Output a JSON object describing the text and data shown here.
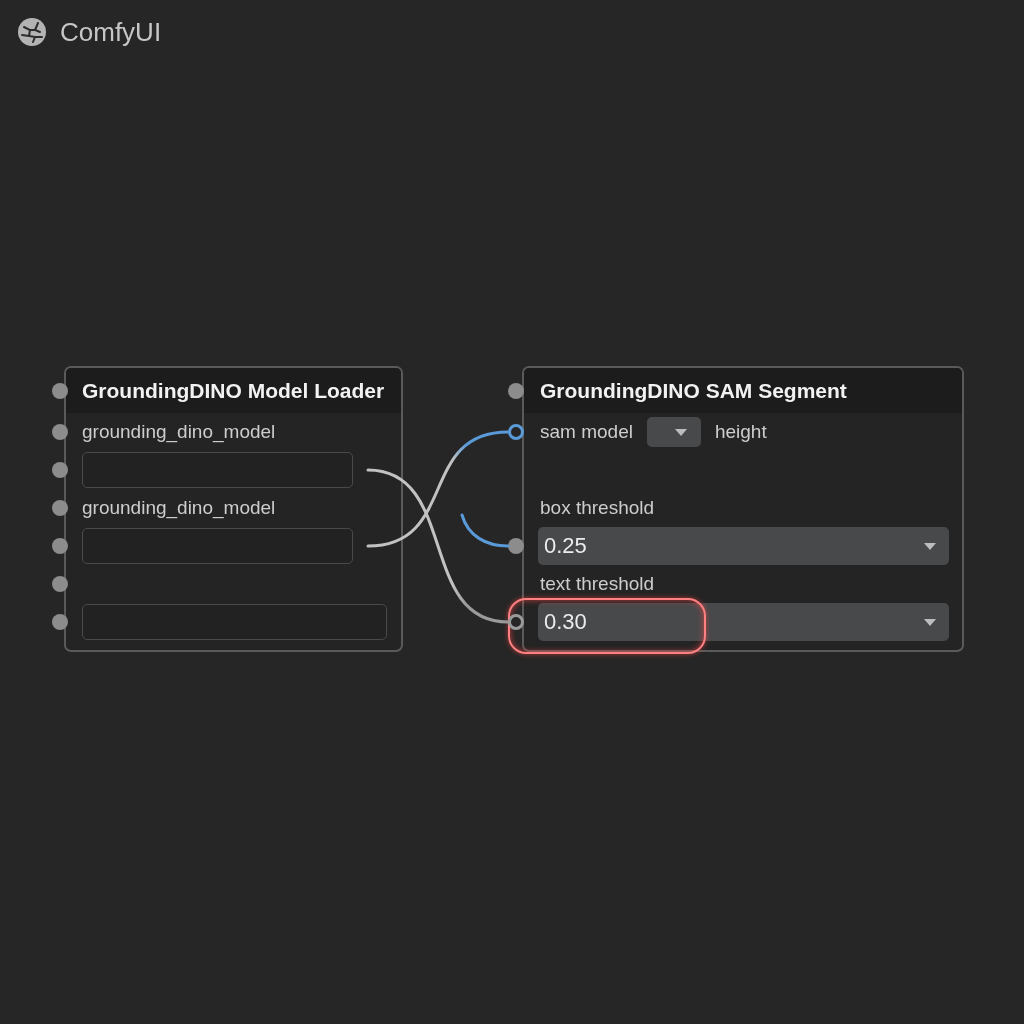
{
  "app": {
    "title": "ComfyUI"
  },
  "nodes": [
    {
      "title": "GroundingDINO Model Loader",
      "title_slot": {
        "kind": "filled",
        "color": "#8c8c8c"
      },
      "rows": [
        {
          "kind": "label",
          "text": "grounding_dino_model",
          "slot": {
            "kind": "filled",
            "color": "#8c8c8c"
          }
        },
        {
          "kind": "field",
          "linked": true,
          "slot": {
            "kind": "filled",
            "color": "#8c8c8c"
          }
        },
        {
          "kind": "label",
          "text": "grounding_dino_model",
          "slot": {
            "kind": "filled",
            "color": "#8c8c8c"
          }
        },
        {
          "kind": "field",
          "linked": true,
          "slot": {
            "kind": "filled",
            "color": "#8c8c8c"
          }
        },
        {
          "kind": "empty",
          "slot": {
            "kind": "filled",
            "color": "#8c8c8c"
          }
        },
        {
          "kind": "field",
          "linked": false,
          "slot": {
            "kind": "filled",
            "color": "#8c8c8c"
          }
        }
      ]
    },
    {
      "title": "GroundingDINO SAM Segment",
      "title_slot": {
        "kind": "filled",
        "color": "#8c8c8c"
      },
      "rows": [
        {
          "kind": "inline",
          "label": "sam model",
          "after": "height",
          "slot": {
            "kind": "ring",
            "color": "#5a9ad8"
          }
        },
        {
          "kind": "empty"
        },
        {
          "kind": "label",
          "text": "box threshold"
        },
        {
          "kind": "dropdown",
          "value": "0.25",
          "highlighted": false,
          "slot": {
            "kind": "filled",
            "color": "#8c8c8c"
          }
        },
        {
          "kind": "label",
          "text": "text threshold"
        },
        {
          "kind": "dropdown",
          "value": "0.30",
          "highlighted": true,
          "slot": {
            "kind": "ring",
            "color": "#9a9a9a"
          }
        }
      ]
    }
  ]
}
